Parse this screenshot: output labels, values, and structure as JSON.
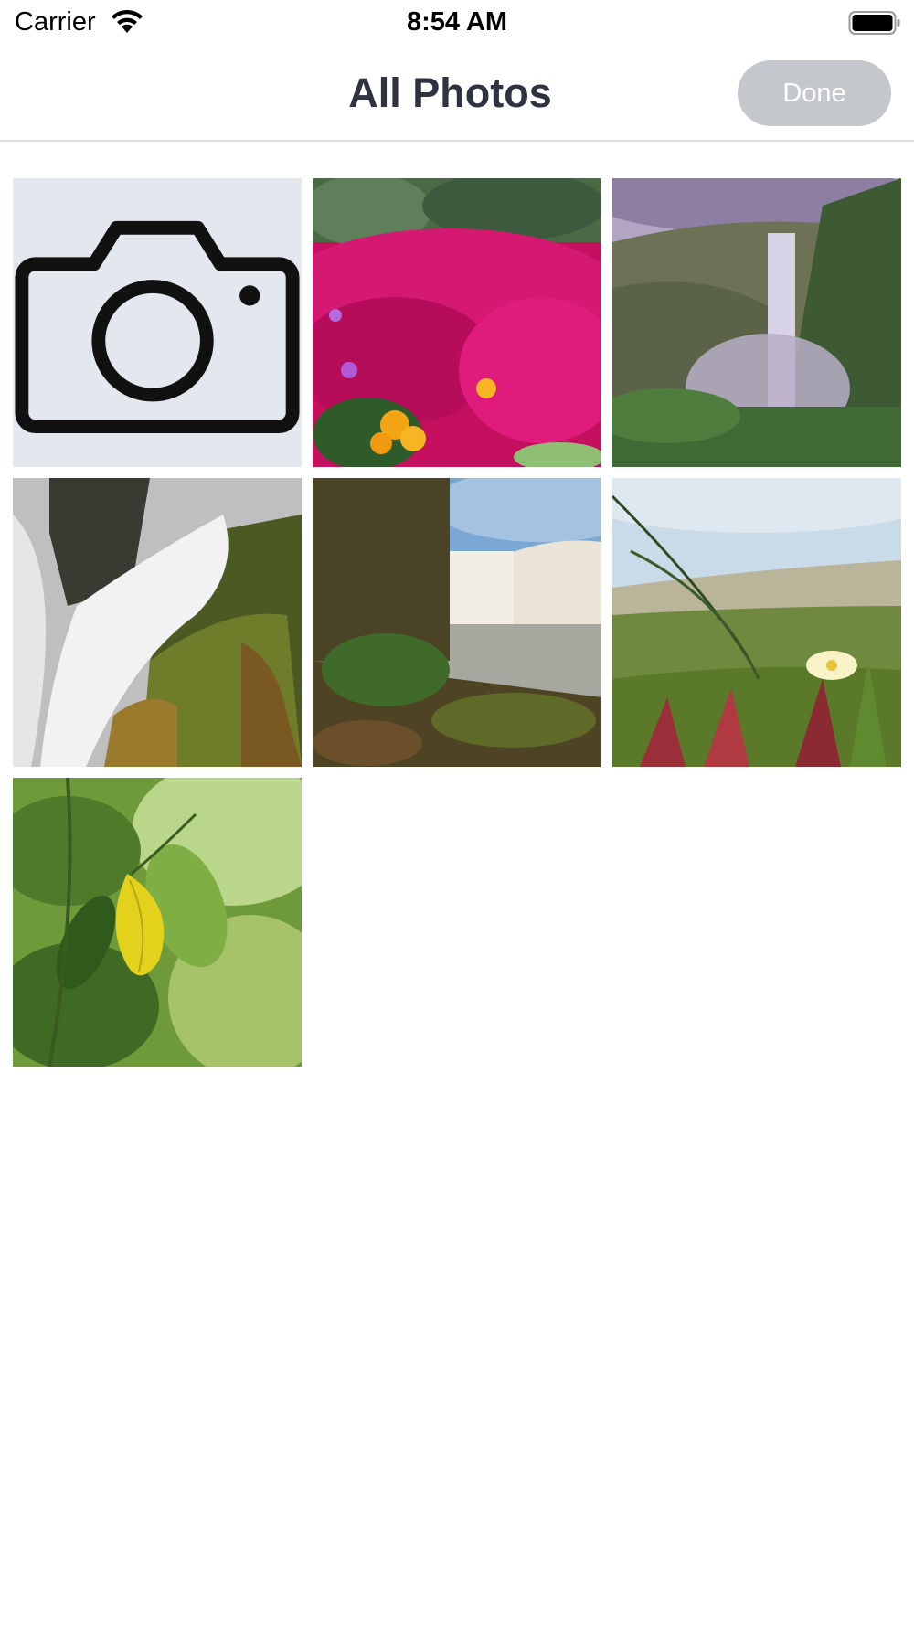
{
  "status_bar": {
    "carrier": "Carrier",
    "time": "8:54 AM",
    "wifi_icon": "wifi-icon",
    "battery_icon": "battery-icon"
  },
  "nav": {
    "title": "All Photos",
    "done_label": "Done"
  },
  "grid": {
    "camera_icon": "camera-icon",
    "photos": [
      {
        "subject": "pink-flowers"
      },
      {
        "subject": "waterfall-cliff"
      },
      {
        "subject": "waterfall-rocks"
      },
      {
        "subject": "waterfall-river"
      },
      {
        "subject": "beach-plant"
      },
      {
        "subject": "yellow-leaf"
      }
    ]
  },
  "colors": {
    "title": "#2e3341",
    "done_bg": "#c4c7cc",
    "camera_tile_bg": "#e3e7ee",
    "divider": "#d9dbe0"
  }
}
